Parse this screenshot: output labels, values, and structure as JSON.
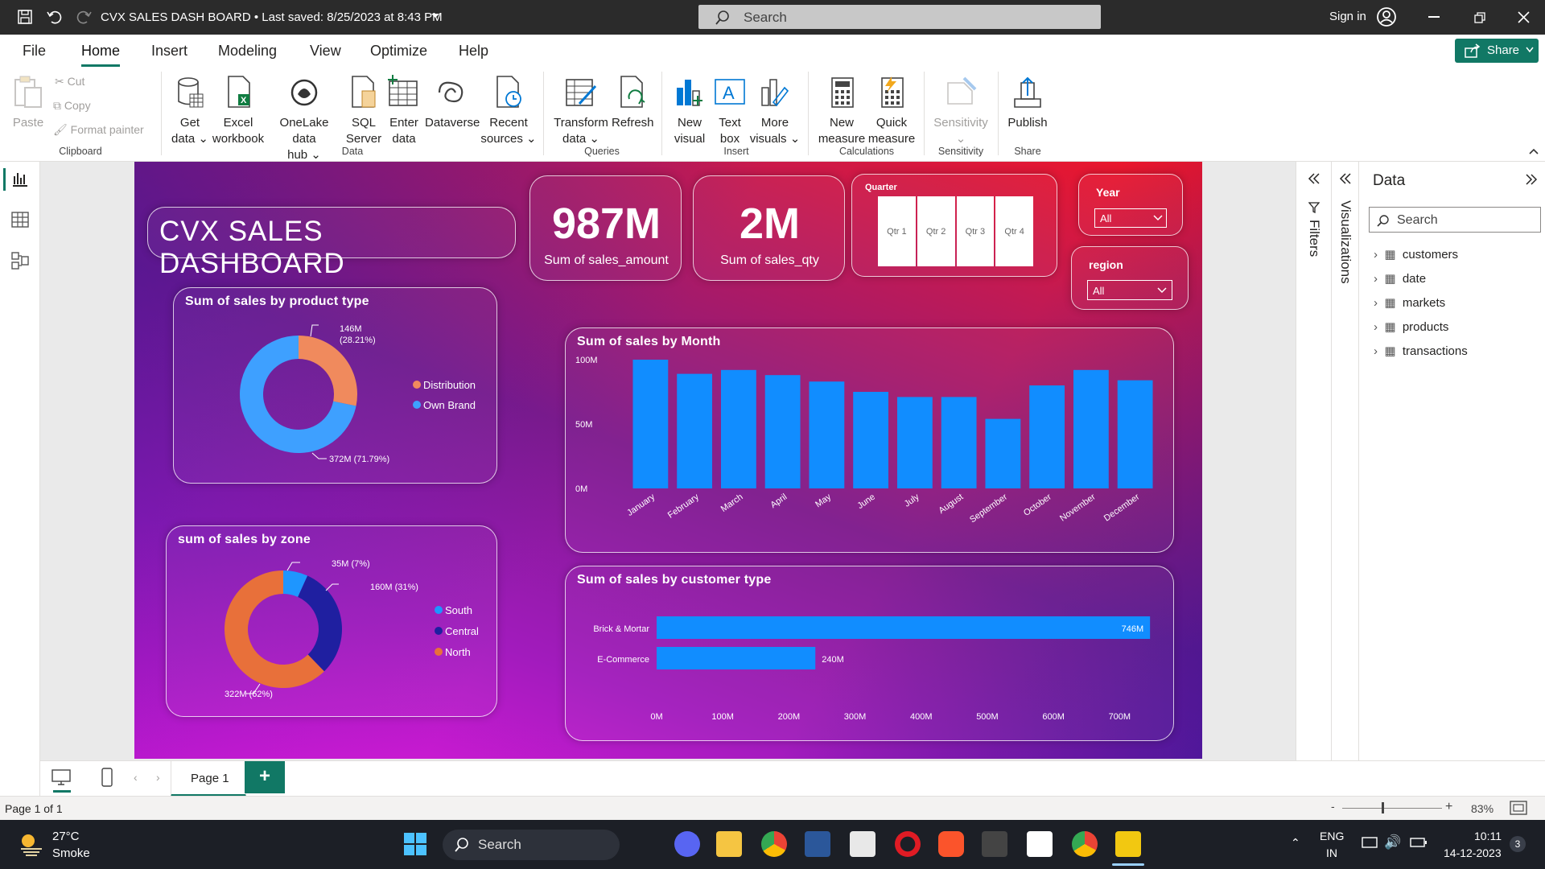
{
  "titlebar": {
    "doc_title": "CVX SALES DASH BOARD • Last saved: 8/25/2023 at 8:43 PM",
    "search_placeholder": "Search",
    "sign_in": "Sign in"
  },
  "tabs": [
    "File",
    "Home",
    "Insert",
    "Modeling",
    "View",
    "Optimize",
    "Help"
  ],
  "share_label": "Share",
  "ribbon": {
    "clipboard": {
      "paste": "Paste",
      "cut": "Cut",
      "copy": "Copy",
      "format_painter": "Format painter",
      "group": "Clipboard"
    },
    "data": {
      "get_data": [
        "Get",
        "data"
      ],
      "excel": [
        "Excel",
        "workbook"
      ],
      "onelake": [
        "OneLake data",
        "hub"
      ],
      "sql": [
        "SQL",
        "Server"
      ],
      "enter": [
        "Enter",
        "data"
      ],
      "dataverse": [
        "Dataverse",
        ""
      ],
      "recent": [
        "Recent",
        "sources"
      ],
      "group": "Data"
    },
    "queries": {
      "transform": [
        "Transform",
        "data"
      ],
      "refresh": [
        "Refresh",
        ""
      ],
      "group": "Queries"
    },
    "insert": {
      "new_visual": [
        "New",
        "visual"
      ],
      "text_box": [
        "Text",
        "box"
      ],
      "more_visuals": [
        "More",
        "visuals"
      ],
      "group": "Insert"
    },
    "calculations": {
      "new_measure": [
        "New",
        "measure"
      ],
      "quick_measure": [
        "Quick",
        "measure"
      ],
      "group": "Calculations"
    },
    "sensitivity": {
      "label": [
        "Sensitivity",
        ""
      ],
      "group": "Sensitivity"
    },
    "share": {
      "publish": [
        "Publish",
        ""
      ],
      "group": "Share"
    }
  },
  "report": {
    "title": "CVX SALES DASHBOARD",
    "kpi_amount": {
      "value": "987M",
      "label": "Sum of sales_amount"
    },
    "kpi_qty": {
      "value": "2M",
      "label": "Sum of sales_qty"
    },
    "quarter_slicer": {
      "title": "Quarter",
      "options": [
        "Qtr 1",
        "Qtr 2",
        "Qtr 3",
        "Qtr 4"
      ]
    },
    "year_slicer": {
      "title": "Year",
      "value": "All"
    },
    "region_slicer": {
      "title": "region",
      "value": "All"
    }
  },
  "chart_data": [
    {
      "type": "pie",
      "title": "Sum of sales by product type",
      "slices": [
        {
          "name": "Distribution",
          "value": 146,
          "label": "146M",
          "pct_label": "(28.21%)",
          "color": "#f08a5d"
        },
        {
          "name": "Own Brand",
          "value": 372,
          "label": "372M (71.79%)",
          "color": "#3ea0ff"
        }
      ],
      "legend": "right"
    },
    {
      "type": "pie",
      "title": "sum of sales by zone",
      "slices": [
        {
          "name": "South",
          "value": 35,
          "label": "35M (7%)",
          "color": "#1e96ff"
        },
        {
          "name": "Central",
          "value": 160,
          "label": "160M (31%)",
          "color": "#1f1fa0"
        },
        {
          "name": "North",
          "value": 322,
          "label": "322M (62%)",
          "color": "#e8703a"
        }
      ],
      "legend": "right"
    },
    {
      "type": "bar",
      "title": "Sum of sales by Month",
      "categories": [
        "January",
        "February",
        "March",
        "April",
        "May",
        "June",
        "July",
        "August",
        "September",
        "October",
        "November",
        "December"
      ],
      "values": [
        100,
        89,
        92,
        88,
        83,
        75,
        71,
        71,
        54,
        80,
        92,
        84
      ],
      "yticks": [
        "100M",
        "50M",
        "0M"
      ],
      "ylim": [
        0,
        100
      ],
      "color": "#118dff"
    },
    {
      "type": "bar",
      "orientation": "horizontal",
      "title": "Sum of sales by customer type",
      "categories": [
        "Brick & Mortar",
        "E-Commerce"
      ],
      "values": [
        746,
        240
      ],
      "value_labels": [
        "746M",
        "240M"
      ],
      "xticks": [
        "0M",
        "100M",
        "200M",
        "300M",
        "400M",
        "500M",
        "600M",
        "700M"
      ],
      "xlim": [
        0,
        750
      ],
      "color": "#118dff"
    }
  ],
  "panes": {
    "filters": "Filters",
    "visualizations": "Visualizations",
    "data_title": "Data",
    "data_search": "Search",
    "tables": [
      "customers",
      "date",
      "markets",
      "products",
      "transactions"
    ]
  },
  "pagebar": {
    "page_tab": "Page 1",
    "add": "+"
  },
  "status": {
    "page_info": "Page 1 of 1",
    "zoom": "83%"
  },
  "taskbar": {
    "temp": "27°C",
    "weather": "Smoke",
    "search": "Search",
    "lang1": "ENG",
    "lang2": "IN",
    "time": "10:11",
    "date": "14-12-2023",
    "badge": "3"
  }
}
